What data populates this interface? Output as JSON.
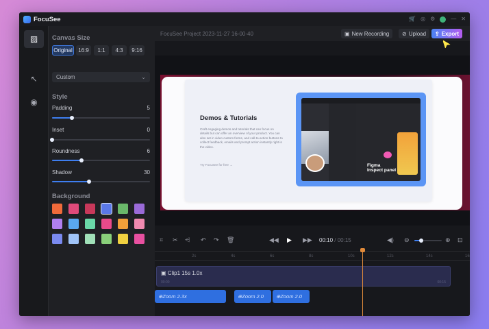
{
  "app": {
    "name": "FocuSee"
  },
  "sidebar": {
    "canvas_size": {
      "title": "Canvas Size",
      "ratios": [
        "Original",
        "16:9",
        "1:1",
        "4:3",
        "9:16"
      ],
      "selected": "Original",
      "preset": "Custom"
    },
    "style": {
      "title": "Style",
      "padding": {
        "label": "Padding",
        "value": "5"
      },
      "inset": {
        "label": "Inset",
        "value": "0"
      },
      "roundness": {
        "label": "Roundness",
        "value": "6"
      },
      "shadow": {
        "label": "Shadow",
        "value": "30"
      }
    },
    "background": {
      "title": "Background",
      "swatches": [
        "#f06a3a",
        "#e04a7a",
        "#c8385a",
        "#5a78e8",
        "#6ab86a",
        "#9a6ad8",
        "#b07ff0",
        "#5aa8f0",
        "#6ad8a8",
        "#e84a8a",
        "#f0a03a",
        "#f08ab0",
        "#7a8af0",
        "#a0c4f8",
        "#a0e0b8",
        "#8ad07a",
        "#f0d040",
        "#e850a0"
      ]
    },
    "slider_levels": {
      "padding": 0.2,
      "inset": 0.0,
      "roundness": 0.3,
      "shadow": 0.38
    }
  },
  "rail": {
    "icons": [
      "background-icon",
      "cursor-icon",
      "camera-icon"
    ]
  },
  "topbar": {
    "project": "FocuSee Project 2023-11-27 16-00-40",
    "new_recording": "New Recording",
    "upload": "Upload",
    "export": "Export"
  },
  "preview": {
    "heading": "Demos & Tutorials",
    "body": "Craft engaging demos and tutorials that can focus on details but can offer an overview of your product. You can also set in video custom forms, and call-to-action buttons to collect feedback, emails and prompt action instantly right in the video.",
    "link": "Try FocuSee for free →",
    "figma_line1": "Figma",
    "figma_line2": "Inspect panel"
  },
  "playback": {
    "current": "00:10",
    "sep": " / ",
    "total": "00:15",
    "zoom_level": 0.25
  },
  "timeline": {
    "ticks": [
      "2s",
      "4s",
      "6s",
      "8s",
      "10s",
      "12s",
      "14s",
      "16s"
    ],
    "clip": {
      "title": "Clip1  15s    1.0x",
      "start": "00:00",
      "end": "00:15"
    },
    "zooms": [
      {
        "label": "Zoom  2.3x"
      },
      {
        "label": "Zoom  2.0"
      },
      {
        "label": "Zoom  2.0"
      }
    ]
  }
}
